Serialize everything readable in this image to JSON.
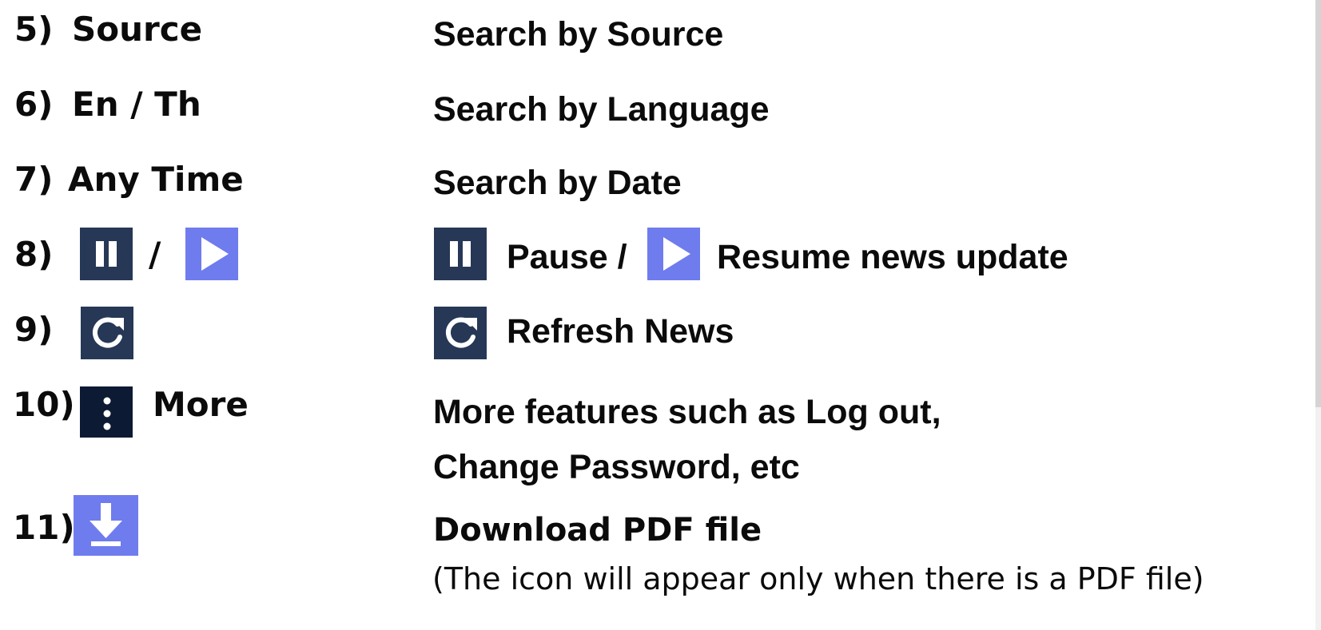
{
  "rows": {
    "r5": {
      "number": "5)",
      "label": "Source",
      "description": "Search by Source"
    },
    "r6": {
      "number": "6)",
      "label": "En / Th",
      "description": "Search by Language"
    },
    "r7": {
      "number": "7)",
      "label": "Any Time",
      "description": "Search by Date"
    },
    "r8": {
      "number": "8)",
      "separator": "/",
      "description_pause": "Pause /",
      "description_resume": "Resume news update"
    },
    "r9": {
      "number": "9)",
      "description": "Refresh News"
    },
    "r10": {
      "number": "10)",
      "label": "More",
      "description_line1": "More features such as Log out,",
      "description_line2": "Change Password, etc"
    },
    "r11": {
      "number": "11)",
      "description": "Download PDF file",
      "note": "(The icon will appear only when there is a PDF file)"
    }
  },
  "icons": {
    "pause": "pause-icon",
    "play": "play-icon",
    "refresh": "refresh-icon",
    "more": "vertical-dots-icon",
    "download": "download-icon"
  },
  "colors": {
    "icon_dark": "#263856",
    "icon_darker": "#0d1a33",
    "icon_blue": "#6f7cee",
    "text": "#0b0b0b"
  }
}
